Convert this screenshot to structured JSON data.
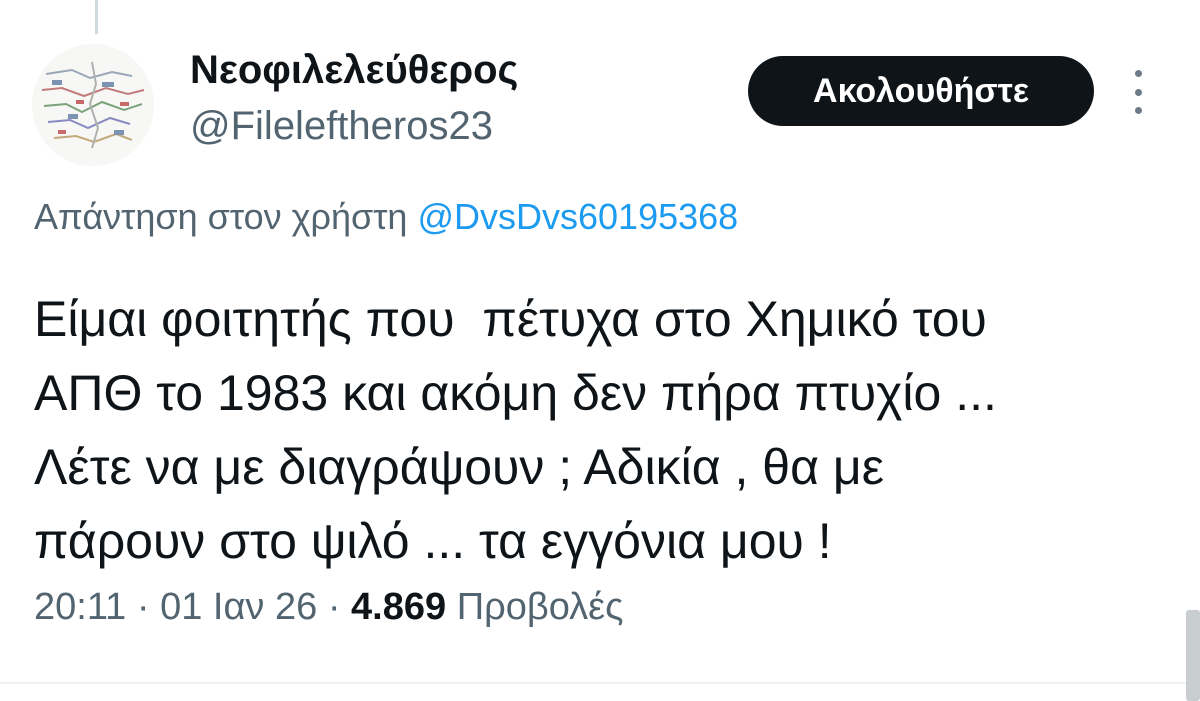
{
  "user": {
    "display_name": "Νεοφιλελεύθερος",
    "handle": "@Fileleftheros23"
  },
  "header": {
    "follow_label": "Ακολουθήστε",
    "more_icon": "more-vertical-icon"
  },
  "reply": {
    "prefix": "Απάντηση στον χρήστη",
    "mention": "@DvsDvs60195368"
  },
  "tweet": {
    "lines": [
      "Είμαι φοιτητής που  πέτυχα στο Χημικό του",
      "ΑΠΘ το 1983 και ακόμη δεν πήρα πτυχίο ...",
      "Λέτε να με διαγράψουν ; Αδικία , θα με",
      "πάρουν στο ψιλό ... τα εγγόνια μου !"
    ]
  },
  "meta": {
    "time": "20:11",
    "separator": "·",
    "date": "01 Ιαν 26",
    "views_count": "4.869",
    "views_label": "Προβολές"
  },
  "colors": {
    "text_primary": "#0f1419",
    "text_secondary": "#536471",
    "link": "#1d9bf0",
    "button_bg": "#0f1419"
  }
}
